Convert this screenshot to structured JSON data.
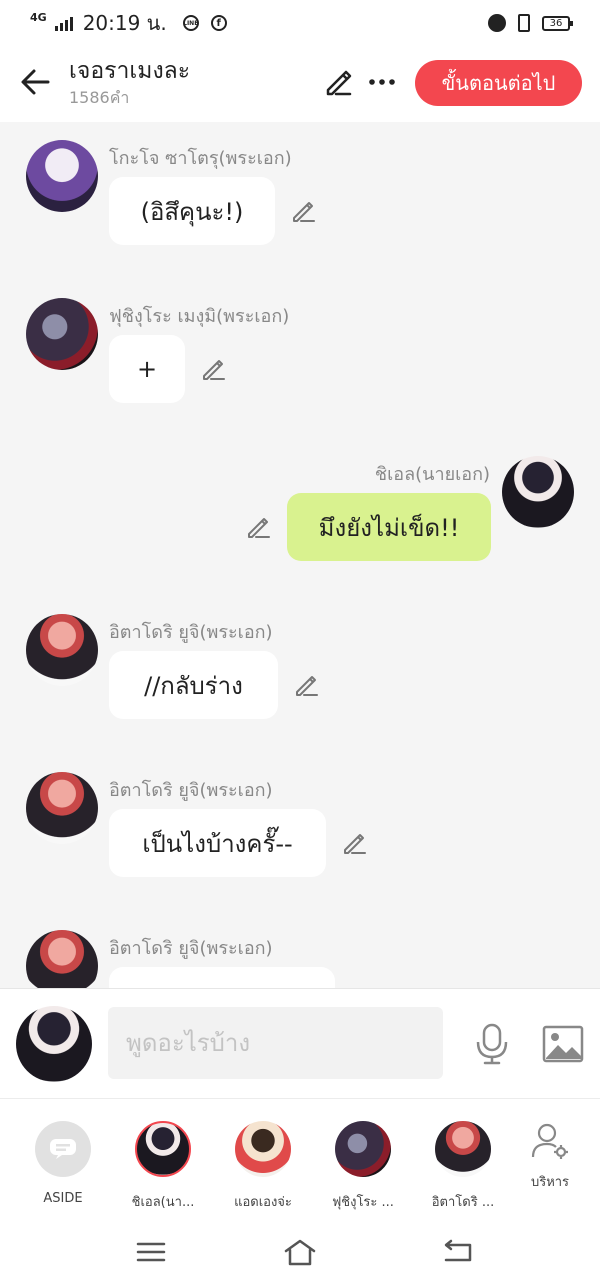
{
  "status_bar": {
    "network": "4G",
    "time": "20:19 น.",
    "battery": "36",
    "notification_icons": [
      "line-icon",
      "facebook-icon"
    ],
    "right_icons": [
      "alarm-icon",
      "vibrate-icon",
      "battery-icon"
    ]
  },
  "header": {
    "title": "เจอราเมงละ",
    "word_count": "1586คำ",
    "next_button": "ขั้นตอนต่อไป",
    "accent_color": "#f3474f"
  },
  "messages": [
    {
      "sender": "โกะโจ ซาโตรุ(พระเอก)",
      "text": "(อิสึคุนะ!)",
      "side": "left",
      "avatar": "gojo"
    },
    {
      "sender": "ฟุชิงุโระ เมงุมิ(พระเอก)",
      "text": "+",
      "side": "left",
      "avatar": "fushiguro"
    },
    {
      "sender": "ชิเอล(นายเอก)",
      "text": "มึงยังไม่เข็ด!!",
      "side": "right",
      "avatar": "ciel"
    },
    {
      "sender": "อิตาโดริ ยูจิ(พระเอก)",
      "text": "//กลับร่าง",
      "side": "left",
      "avatar": "itadori"
    },
    {
      "sender": "อิตาโดริ ยูจิ(พระเอก)",
      "text": "เป็นไงบ้างครั๊--",
      "side": "left",
      "avatar": "itadori"
    },
    {
      "sender": "อิตาโดริ ยูจิ(พระเอก)",
      "text": "",
      "side": "left",
      "avatar": "itadori"
    }
  ],
  "input": {
    "placeholder": "พูดอะไรบ้าง",
    "value": ""
  },
  "characters": [
    {
      "label": "ASIDE",
      "type": "aside"
    },
    {
      "label": "ชิเอล(นา...",
      "type": "avatar",
      "selected": true
    },
    {
      "label": "แอดเองจ่ะ",
      "type": "avatar",
      "selected": false
    },
    {
      "label": "ฟุชิงุโระ ...",
      "type": "avatar",
      "selected": false
    },
    {
      "label": "อิตาโดริ ...",
      "type": "avatar",
      "selected": false
    }
  ],
  "manage": {
    "label": "บริหาร"
  },
  "colors": {
    "my_bubble": "#d9f28f",
    "other_bubble": "#ffffff",
    "chat_background": "#f5f5f5"
  }
}
